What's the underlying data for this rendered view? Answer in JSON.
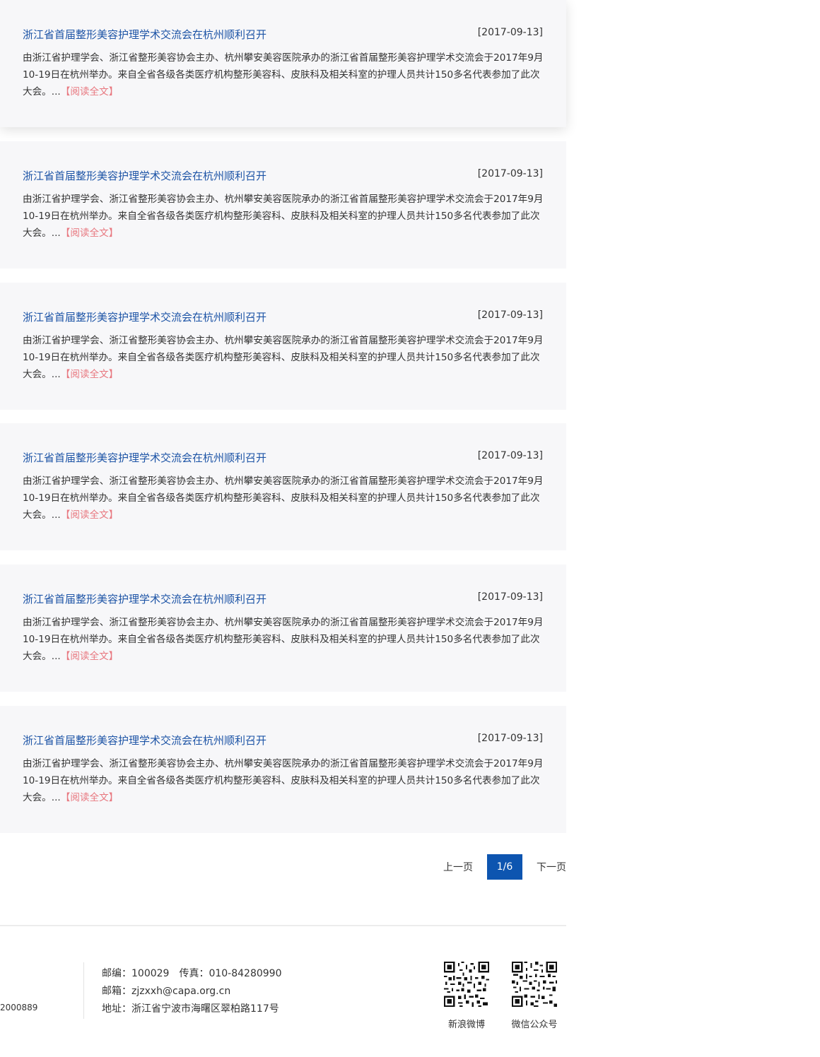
{
  "news": [
    {
      "title": "浙江省首届整形美容护理学术交流会在杭州顺利召开",
      "date": "[2017-09-13]",
      "summary": "由浙江省护理学会、浙江省整形美容协会主办、杭州攀安美容医院承办的浙江省首届整形美容护理学术交流会于2017年9月10-19日在杭州举办。来自全省各级各类医疗机构整形美容科、皮肤科及相关科室的护理人员共计150多名代表参加了此次大会。...",
      "read_more": "【阅读全文】"
    },
    {
      "title": "浙江省首届整形美容护理学术交流会在杭州顺利召开",
      "date": "[2017-09-13]",
      "summary": "由浙江省护理学会、浙江省整形美容协会主办、杭州攀安美容医院承办的浙江省首届整形美容护理学术交流会于2017年9月10-19日在杭州举办。来自全省各级各类医疗机构整形美容科、皮肤科及相关科室的护理人员共计150多名代表参加了此次大会。...",
      "read_more": "【阅读全文】"
    },
    {
      "title": "浙江省首届整形美容护理学术交流会在杭州顺利召开",
      "date": "[2017-09-13]",
      "summary": "由浙江省护理学会、浙江省整形美容协会主办、杭州攀安美容医院承办的浙江省首届整形美容护理学术交流会于2017年9月10-19日在杭州举办。来自全省各级各类医疗机构整形美容科、皮肤科及相关科室的护理人员共计150多名代表参加了此次大会。...",
      "read_more": "【阅读全文】"
    },
    {
      "title": "浙江省首届整形美容护理学术交流会在杭州顺利召开",
      "date": "[2017-09-13]",
      "summary": "由浙江省护理学会、浙江省整形美容协会主办、杭州攀安美容医院承办的浙江省首届整形美容护理学术交流会于2017年9月10-19日在杭州举办。来自全省各级各类医疗机构整形美容科、皮肤科及相关科室的护理人员共计150多名代表参加了此次大会。...",
      "read_more": "【阅读全文】"
    },
    {
      "title": "浙江省首届整形美容护理学术交流会在杭州顺利召开",
      "date": "[2017-09-13]",
      "summary": "由浙江省护理学会、浙江省整形美容协会主办、杭州攀安美容医院承办的浙江省首届整形美容护理学术交流会于2017年9月10-19日在杭州举办。来自全省各级各类医疗机构整形美容科、皮肤科及相关科室的护理人员共计150多名代表参加了此次大会。...",
      "read_more": "【阅读全文】"
    },
    {
      "title": "浙江省首届整形美容护理学术交流会在杭州顺利召开",
      "date": "[2017-09-13]",
      "summary": "由浙江省护理学会、浙江省整形美容协会主办、杭州攀安美容医院承办的浙江省首届整形美容护理学术交流会于2017年9月10-19日在杭州举办。来自全省各级各类医疗机构整形美容科、皮肤科及相关科室的护理人员共计150多名代表参加了此次大会。...",
      "read_more": "【阅读全文】"
    }
  ],
  "pagination": {
    "prev": "上一页",
    "current": "1/6",
    "next": "下一页"
  },
  "footer": {
    "left_text": "2000889",
    "postcode_label": "邮编：",
    "postcode": "100029",
    "fax_label": "传真：",
    "fax": "010-84280990",
    "email_label": "邮箱：",
    "email": "zjzxxh@capa.org.cn",
    "address_label": "地址：",
    "address": "浙江省宁波市海曙区翠柏路117号",
    "qr": [
      {
        "label": "新浪微博",
        "icon": "qr-code-icon"
      },
      {
        "label": "微信公众号",
        "icon": "qr-code-icon"
      }
    ]
  },
  "colors": {
    "title": "#1d54a6",
    "read_more": "#e8777f",
    "page_active": "#0d55b0",
    "item_bg": "#f7f7f9"
  }
}
